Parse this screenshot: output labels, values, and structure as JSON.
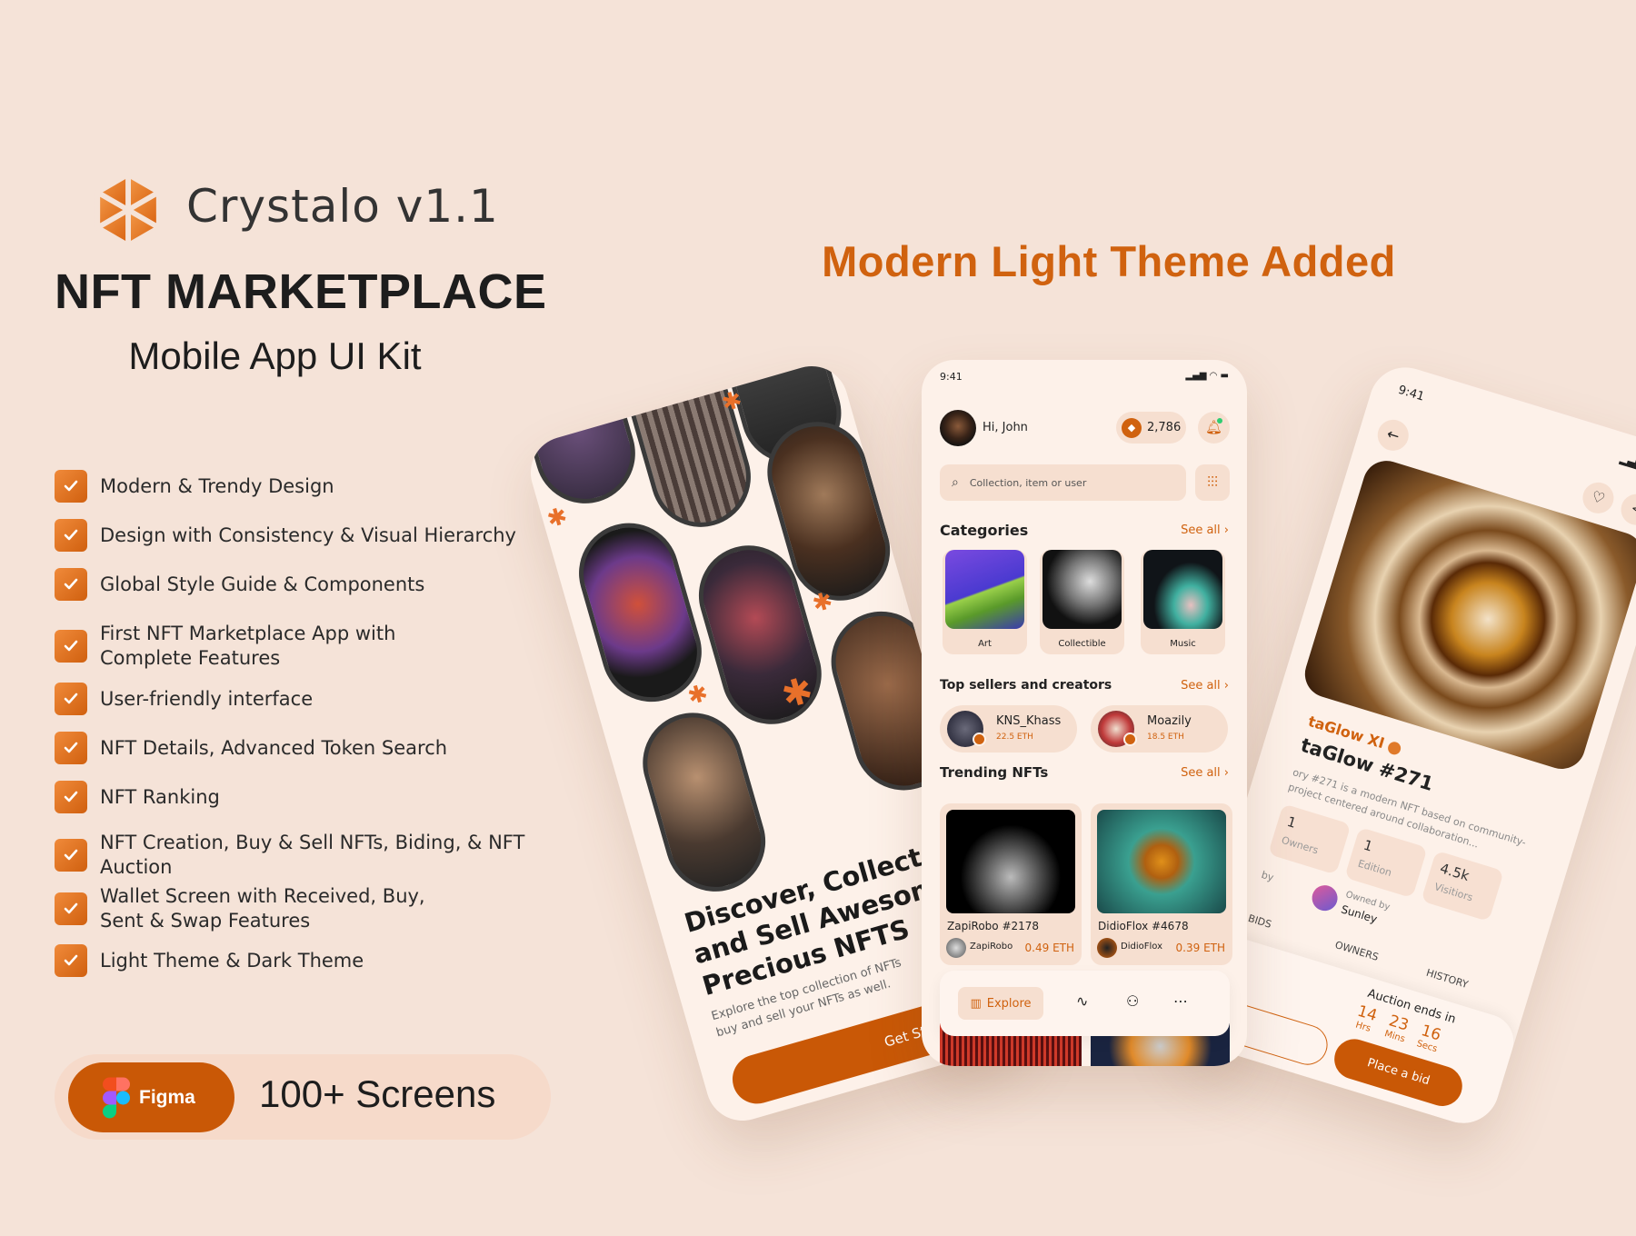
{
  "brand": {
    "name": "Crystalo v1.1",
    "title": "NFT MARKETPLACE",
    "subtitle": "Mobile App UI Kit",
    "logo_icon": "crystal-hexagon-logo"
  },
  "features": [
    "Modern & Trendy Design",
    "Design with Consistency & Visual Hierarchy",
    "Global Style Guide & Components",
    "First NFT Marketplace App with\nComplete Features",
    "User-friendly interface",
    "NFT Details, Advanced Token Search",
    "NFT Ranking",
    "NFT Creation, Buy & Sell NFTs, Biding, & NFT Auction",
    "Wallet Screen with Received, Buy,\nSent & Swap Features",
    "Light Theme  & Dark Theme"
  ],
  "badge": {
    "figma_label": "Figma",
    "screens": "100+ Screens"
  },
  "headline": "Modern Light Theme Added",
  "colors": {
    "accent": "#CC5A0A",
    "background": "#F5E3D8",
    "phone": "#FDF1E9",
    "card": "#F6DFD0"
  },
  "onboarding": {
    "heading": "Discover, Collect and Sell Awesome Precious NFTS",
    "body": "Explore the top collection of NFTs buy and sell your NFTs as well.",
    "cta": "Get Started"
  },
  "home": {
    "time": "9:41",
    "greeting": "Hi, John",
    "balance": "2,786",
    "search_placeholder": "Collection, item or user",
    "categories_title": "Categories",
    "see_all": "See all",
    "categories": [
      {
        "label": "Art"
      },
      {
        "label": "Collectible"
      },
      {
        "label": "Music"
      }
    ],
    "sellers_title": "Top sellers and creators",
    "sellers": [
      {
        "name": "KNS_Khass",
        "price": "22.5 ETH"
      },
      {
        "name": "Moazily",
        "price": "18.5 ETH"
      }
    ],
    "trending_title": "Trending NFTs",
    "trending": [
      {
        "name": "ZapiRobo #2178",
        "owner": "ZapiRobo",
        "price": "0.49 ETH"
      },
      {
        "name": "DidioFlox #4678",
        "owner": "DidioFlox",
        "price": "0.39 ETH"
      }
    ],
    "nav": {
      "explore": "Explore"
    }
  },
  "detail": {
    "time": "9:41",
    "collection": "taGlow XI",
    "title": "taGlow #271",
    "description_1": "ory #271 is a modern NFT based on community-",
    "description_2": "project centered around collaboration...",
    "stats": [
      {
        "value": "1",
        "label": "Owners"
      },
      {
        "value": "1",
        "label": "Edition"
      },
      {
        "value": "4.5k",
        "label": "Visitiors"
      }
    ],
    "created_label": "by",
    "owned_label": "Owned by",
    "owner": "Sunley",
    "tabs": [
      "BIDS",
      "OWNERS",
      "HISTORY"
    ],
    "auction_label": "Auction ends in",
    "countdown": [
      {
        "value": "14",
        "unit": "Hrs"
      },
      {
        "value": "23",
        "unit": "Mins"
      },
      {
        "value": "16",
        "unit": "Secs"
      }
    ],
    "cta": "Place a bid"
  }
}
